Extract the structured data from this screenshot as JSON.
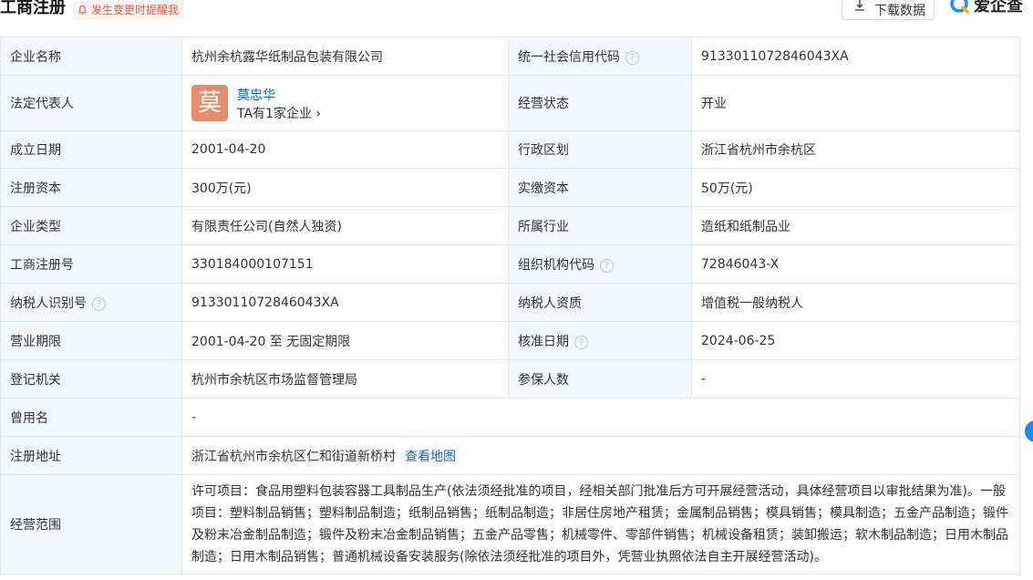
{
  "header": {
    "title": "工商注册",
    "remind_label": "发生变更时提醒我",
    "download_label": "下载数据",
    "logo_text": "爱企查"
  },
  "rows": [
    {
      "label1": "企业名称",
      "value1": "杭州余杭露华纸制品包装有限公司",
      "label2": "统一社会信用代码",
      "value2": "913301107284604 3XA"
    },
    {
      "label1": "法定代表人",
      "legal_name": "莫忠华",
      "legal_avatar_char": "莫",
      "legal_sub": "TA有1家企业",
      "label2": "经营状态",
      "value2": "开业"
    },
    {
      "label1": "成立日期",
      "value1": "2001-04-20",
      "label2": "行政区划",
      "value2": "浙江省杭州市余杭区"
    },
    {
      "label1": "注册资本",
      "value1": "300万(元)",
      "label2": "实缴资本",
      "value2": "50万(元)"
    },
    {
      "label1": "企业类型",
      "value1": "有限责任公司(自然人独资)",
      "label2": "所属行业",
      "value2": "造纸和纸制品业"
    },
    {
      "label1": "工商注册号",
      "value1": "330184000107151",
      "label2": "组织机构代码",
      "value2": "72846043-X"
    },
    {
      "label1": "纳税人识别号",
      "value1": "9133011072846043XA",
      "label2": "纳税人资质",
      "value2": "增值税一般纳税人"
    },
    {
      "label1": "营业期限",
      "value1": "2001-04-20 至 无固定期限",
      "label2": "核准日期",
      "value2": "2024-06-25"
    },
    {
      "label1": "登记机关",
      "value1": "杭州市余杭区市场监督管理局",
      "label2": "参保人数",
      "value2": "-"
    },
    {
      "label1": "曾用名",
      "value1": "-"
    },
    {
      "label1": "注册地址",
      "value1": "浙江省杭州市余杭区仁和街道新桥村",
      "link": "查看地图"
    },
    {
      "label1": "经营范围",
      "value1": "许可项目：食品用塑料包装容器工具制品生产(依法须经批准的项目，经相关部门批准后方可开展经营活动，具体经营项目以审批结果为准)。一般项目：塑料制品销售；塑料制品制造；纸制品销售；纸制品制造；非居住房地产租赁；金属制品销售；模具销售；模具制造；五金产品制造；锻件及粉末冶金制品制造；锻件及粉末冶金制品销售；五金产品零售；机械零件、零部件销售；机械设备租赁；装卸搬运；软木制品制造；日用木制品制造；日用木制品销售；普通机械设备安装服务(除依法须经批准的项目外，凭营业执照依法自主开展经营活动)。"
    }
  ],
  "colors": {
    "label_bg": "#f2f8fe",
    "link": "#1467d6",
    "avatar": "#e58d6c",
    "remind": "#f25a3c"
  }
}
